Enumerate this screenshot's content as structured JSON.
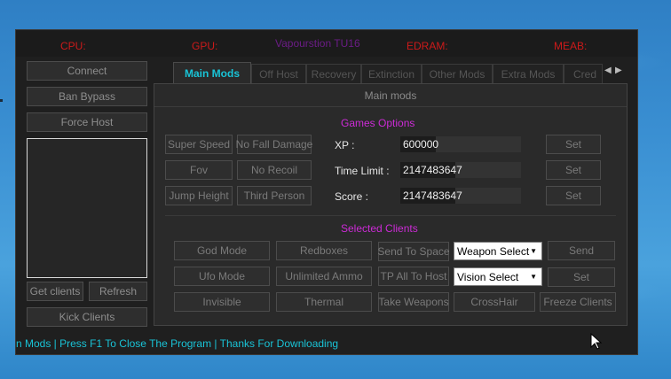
{
  "topbar": {
    "cpu": "CPU:",
    "gpu": "GPU:",
    "app_title": "Vapourstion TU16",
    "edram": "EDRAM:",
    "meab": "MEAB:"
  },
  "left": {
    "connect": "Connect",
    "ban_bypass": "Ban Bypass",
    "force_host": "Force Host",
    "get_clients": "Get clients",
    "refresh": "Refresh",
    "kick_clients": "Kick Clients"
  },
  "tabs": [
    "Main Mods",
    "Off Host",
    "Recovery",
    "Extinction",
    "Other Mods",
    "Extra Mods",
    "Cred"
  ],
  "panel": {
    "title": "Main mods",
    "games_options": "Games Options",
    "selected_clients": "Selected Clients"
  },
  "game_buttons": {
    "super_speed": "Super Speed",
    "no_fall_damage": "No Fall Damage",
    "fov": "Fov",
    "no_recoil": "No Recoil",
    "jump_height": "Jump Height",
    "third_person": "Third Person"
  },
  "fields": {
    "xp_label": "XP :",
    "xp_value": "600000",
    "time_limit_label": "Time Limit :",
    "time_limit_value": "2147483647",
    "score_label": "Score :",
    "score_value": "2147483647",
    "set": "Set"
  },
  "client_buttons": {
    "god_mode": "God Mode",
    "redboxes": "Redboxes",
    "send_to_space": "Send To Space",
    "weapon_select": "Weapon Select",
    "send": "Send",
    "ufo_mode": "Ufo Mode",
    "unlimited_ammo": "Unlimited Ammo",
    "tp_all_to_host": "TP All To Host",
    "vision_select": "Vision Select",
    "set": "Set",
    "invisible": "Invisible",
    "thermal": "Thermal",
    "take_weapons": "Take Weapons",
    "crosshair": "CrossHair",
    "freeze_clients": "Freeze Clients"
  },
  "status_text": "n Mods | Press F1 To Close The Program | Thanks For Downloading",
  "colors": {
    "accent": "#19c3d6",
    "section": "#cc2ad6",
    "stat_red": "#cc1a1a",
    "title_purple": "#6b1c86"
  }
}
